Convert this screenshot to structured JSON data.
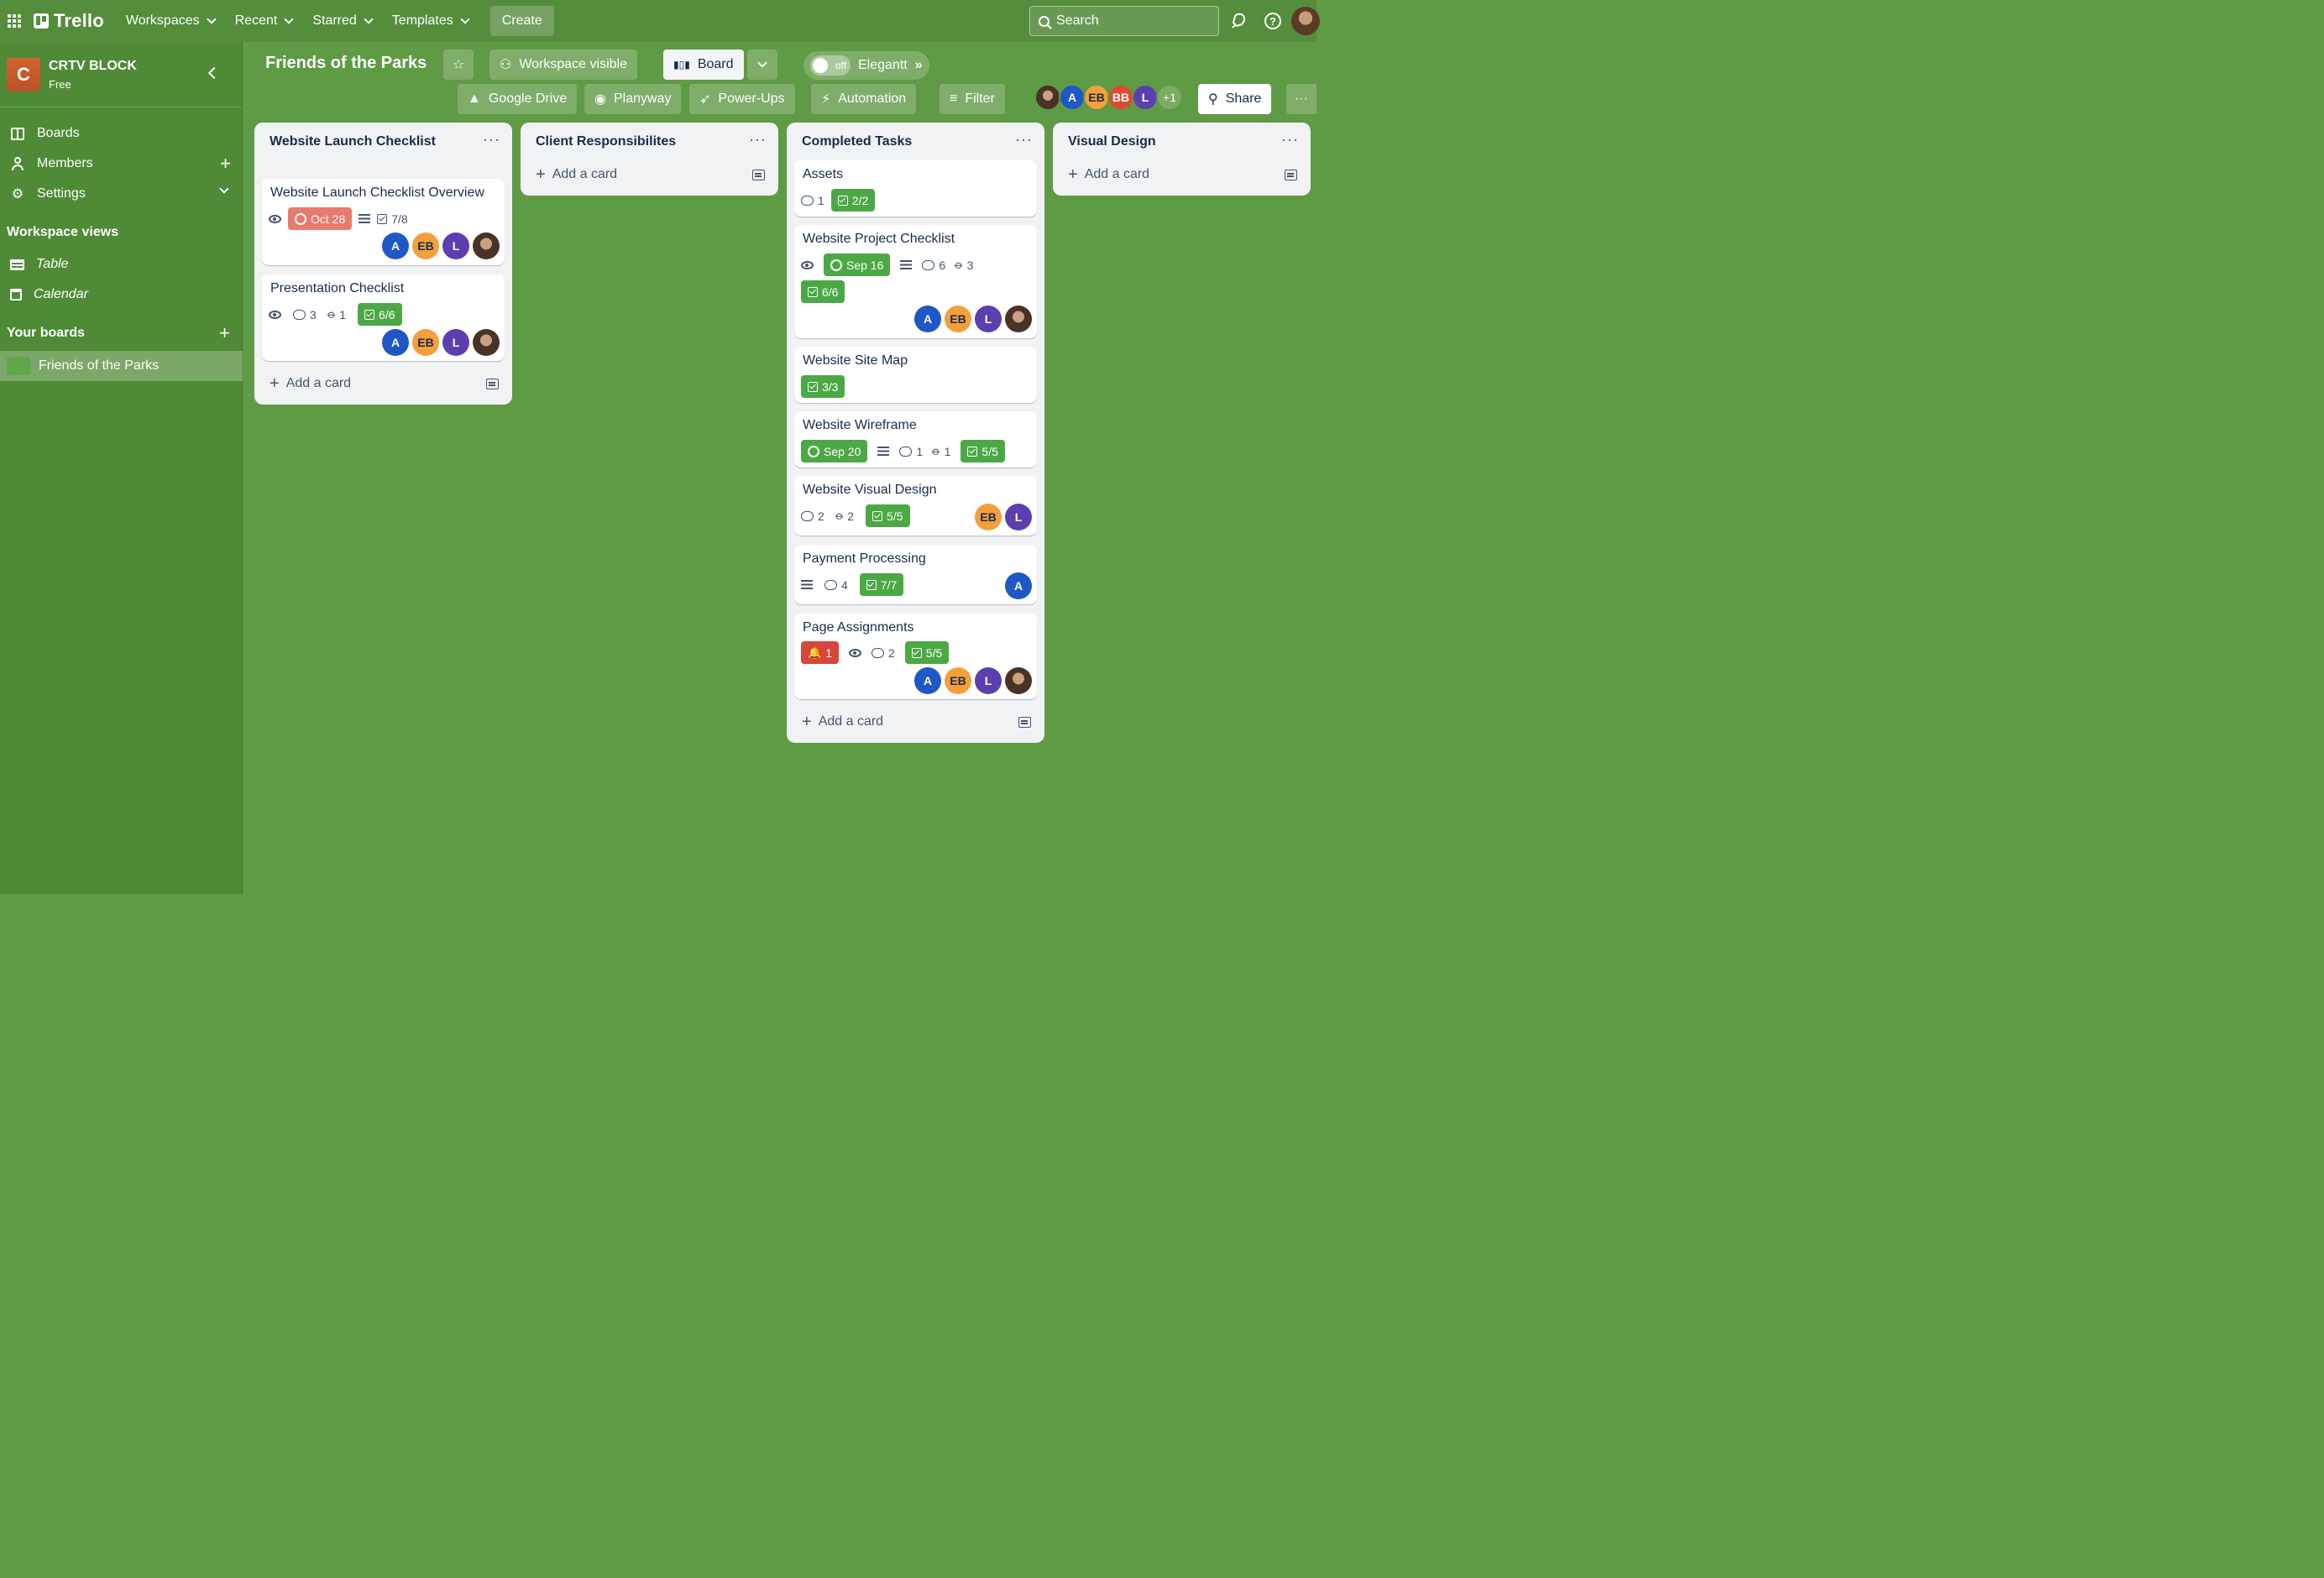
{
  "app": {
    "name": "Trello"
  },
  "nav": {
    "workspaces": "Workspaces",
    "recent": "Recent",
    "starred": "Starred",
    "templates": "Templates",
    "create": "Create",
    "search_placeholder": "Search"
  },
  "sidebar": {
    "workspace_initial": "C",
    "workspace_name": "CRTV BLOCK",
    "workspace_plan": "Free",
    "items": [
      {
        "label": "Boards"
      },
      {
        "label": "Members"
      },
      {
        "label": "Settings"
      }
    ],
    "views_heading": "Workspace views",
    "views": [
      {
        "label": "Table"
      },
      {
        "label": "Calendar"
      }
    ],
    "boards_heading": "Your boards",
    "boards": [
      {
        "label": "Friends of the Parks"
      }
    ]
  },
  "board": {
    "title": "Friends of the Parks",
    "visibility": "Workspace visible",
    "view": "Board",
    "toggle_state": "off",
    "elegantt": "Elegantt",
    "powerups": [
      {
        "label": "Google Drive"
      },
      {
        "label": "Planyway"
      },
      {
        "label": "Power-Ups"
      },
      {
        "label": "Automation"
      }
    ],
    "filter": "Filter",
    "members": [
      {
        "initials": ""
      },
      {
        "initials": "A"
      },
      {
        "initials": "EB"
      },
      {
        "initials": "BB"
      },
      {
        "initials": "L"
      }
    ],
    "more_members": "+1",
    "share": "Share"
  },
  "lists": [
    {
      "title": "Website Launch Checklist",
      "cards": [
        {
          "title": "Website Launch Checklist Overview",
          "due": "Oct 28",
          "checklist": "7/8",
          "members": [
            "A",
            "EB",
            "L",
            ""
          ]
        },
        {
          "title": "Presentation Checklist",
          "comments": "3",
          "attachments": "1",
          "checklist": "6/6",
          "members": [
            "A",
            "EB",
            "L",
            ""
          ]
        }
      ],
      "add_card": "Add a card"
    },
    {
      "title": "Client Responsibilites",
      "cards": [],
      "add_card": "Add a card"
    },
    {
      "title": "Completed Tasks",
      "cards": [
        {
          "title": "Assets",
          "comments": "1",
          "checklist": "2/2"
        },
        {
          "title": "Website Project Checklist",
          "due": "Sep 16",
          "comments": "6",
          "attachments": "3",
          "checklist": "6/6",
          "members": [
            "A",
            "EB",
            "L",
            ""
          ]
        },
        {
          "title": "Website Site Map",
          "checklist": "3/3"
        },
        {
          "title": "Website Wireframe",
          "due": "Sep 20",
          "comments": "1",
          "attachments": "1",
          "checklist": "5/5"
        },
        {
          "title": "Website Visual Design",
          "comments": "2",
          "attachments": "2",
          "checklist": "5/5",
          "members": [
            "EB",
            "L"
          ]
        },
        {
          "title": "Payment Processing",
          "comments": "4",
          "checklist": "7/7",
          "members": [
            "A"
          ]
        },
        {
          "title": "Page Assignments",
          "alerts": "1",
          "comments": "2",
          "checklist": "5/5",
          "members": [
            "A",
            "EB",
            "L",
            ""
          ]
        }
      ],
      "add_card": "Add a card"
    },
    {
      "title": "Visual Design",
      "cards": [],
      "add_card": "Add a card"
    }
  ],
  "icons": [
    "app-grid-icon",
    "trello-logo-icon",
    "search-icon",
    "notification-icon",
    "help-icon",
    "star-icon",
    "board-view-icon",
    "chevron-down-icon",
    "google-drive-icon",
    "planyway-icon",
    "power-ups-icon",
    "automation-icon",
    "filter-icon",
    "share-icon",
    "more-icon",
    "eye-icon",
    "clock-icon",
    "description-icon",
    "comment-icon",
    "attachment-icon",
    "checklist-icon",
    "bell-icon",
    "template-icon"
  ],
  "colors": {
    "board_bg": "#5f9a45",
    "nav_bg": "#548d3c",
    "overdue": "#e97a6e",
    "complete": "#4ca845",
    "alert": "#d9453a"
  }
}
